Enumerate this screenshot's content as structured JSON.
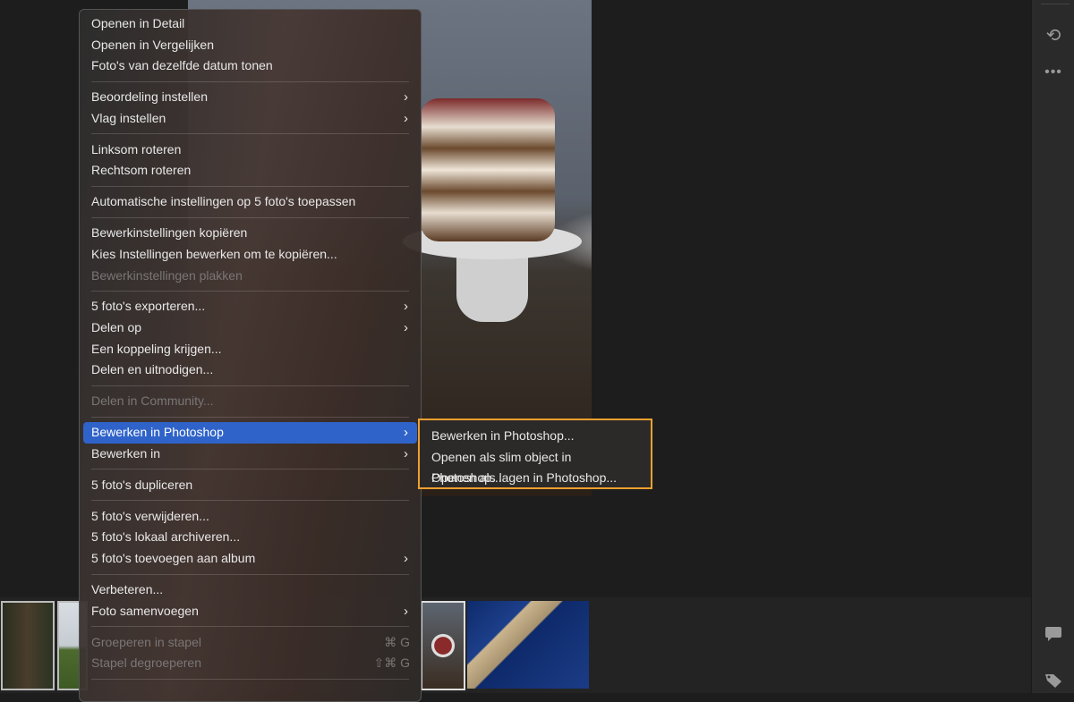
{
  "menu": {
    "items": [
      {
        "label": "Openen in Detail"
      },
      {
        "label": "Openen in Vergelijken"
      },
      {
        "label": "Foto's van dezelfde datum tonen"
      },
      {
        "label": "Beoordeling instellen"
      },
      {
        "label": "Vlag instellen"
      },
      {
        "label": "Linksom roteren"
      },
      {
        "label": "Rechtsom roteren"
      },
      {
        "label": "Automatische instellingen op 5 foto's toepassen"
      },
      {
        "label": "Bewerkinstellingen kopiëren"
      },
      {
        "label": "Kies Instellingen bewerken om te kopiëren..."
      },
      {
        "label": "Bewerkinstellingen plakken"
      },
      {
        "label": "5 foto's exporteren..."
      },
      {
        "label": "Delen op"
      },
      {
        "label": "Een koppeling krijgen..."
      },
      {
        "label": "Delen en uitnodigen..."
      },
      {
        "label": "Delen in Community..."
      },
      {
        "label": "Bewerken in Photoshop"
      },
      {
        "label": "Bewerken in"
      },
      {
        "label": "5 foto's dupliceren"
      },
      {
        "label": "5 foto's verwijderen..."
      },
      {
        "label": "5 foto's lokaal archiveren..."
      },
      {
        "label": "5 foto's toevoegen aan album"
      },
      {
        "label": "Verbeteren..."
      },
      {
        "label": "Foto samenvoegen"
      },
      {
        "label": "Groeperen in stapel",
        "shortcut": "⌘ G"
      },
      {
        "label": "Stapel degroeperen",
        "shortcut": "⇧⌘ G"
      }
    ]
  },
  "submenu": {
    "items": [
      {
        "label": "Bewerken in Photoshop..."
      },
      {
        "label": "Openen als slim object in Photoshop..."
      },
      {
        "label": "Openen als lagen in Photoshop..."
      }
    ]
  },
  "colors": {
    "accent": "#2f63c9",
    "highlight_border": "#f0a030"
  }
}
